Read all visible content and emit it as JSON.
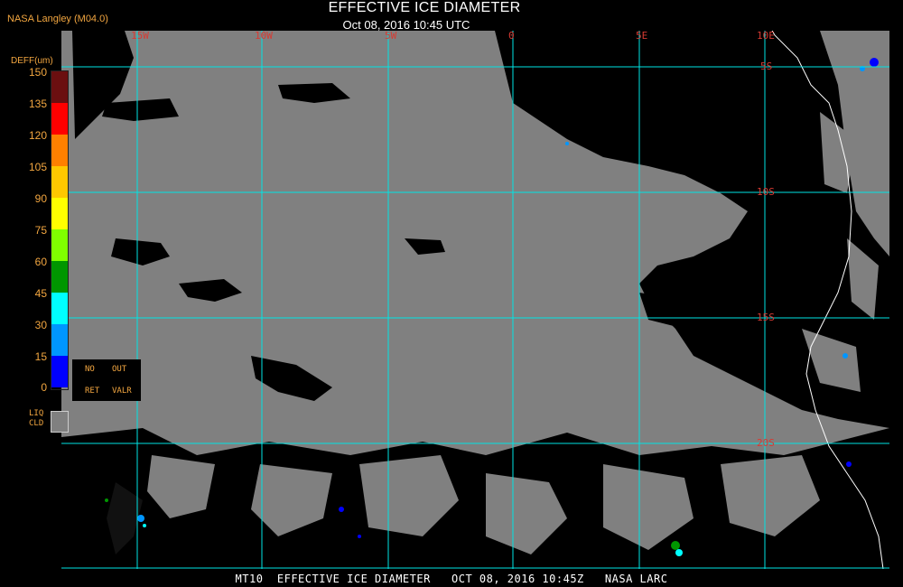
{
  "credit": "NASA Langley (M04.0)",
  "title": "EFFECTIVE ICE DIAMETER",
  "subtitle": "Oct 08, 2016 10:45 UTC",
  "colorbar": {
    "title": "DEFF(um)",
    "ticks": [
      "150",
      "135",
      "120",
      "105",
      "90",
      "75",
      "60",
      "45",
      "30",
      "15",
      "0"
    ],
    "colors": [
      "#6b0f10",
      "#ff0000",
      "#ff8000",
      "#ffc800",
      "#ffff00",
      "#80ff00",
      "#009600",
      "#00ffff",
      "#0096ff",
      "#0000ff",
      "#8020ff"
    ]
  },
  "legend": {
    "no_label": "NO",
    "ret_label": "RET",
    "out_label": "OUT",
    "valr_label": "VALR",
    "liq_label": "LIQ",
    "cld_label": "CLD"
  },
  "longitude_labels": [
    "15W",
    "10W",
    "5W",
    "0",
    "5E",
    "10E"
  ],
  "latitude_labels": [
    "5S",
    "10S",
    "15S",
    "20S"
  ],
  "footer": "MT10  EFFECTIVE ICE DIAMETER   OCT 08, 2016 10:45Z   NASA LARC",
  "colors": {
    "cloud": "#808080",
    "clear": "#000000",
    "grid": "#00e5e5",
    "coast": "#ffffff",
    "label_red": "#d83a32",
    "label_orange": "#f2a640"
  }
}
